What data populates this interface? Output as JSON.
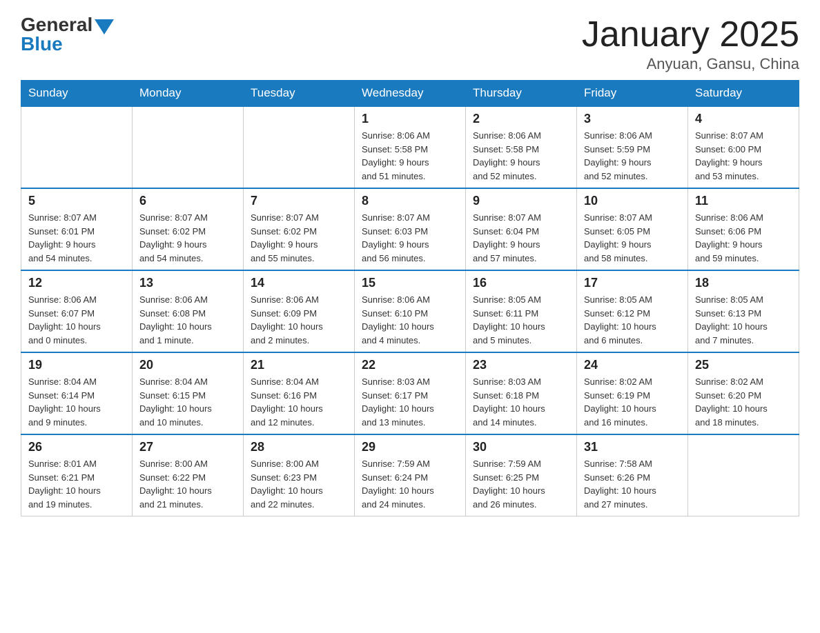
{
  "header": {
    "title": "January 2025",
    "subtitle": "Anyuan, Gansu, China",
    "logo_general": "General",
    "logo_blue": "Blue"
  },
  "days_of_week": [
    "Sunday",
    "Monday",
    "Tuesday",
    "Wednesday",
    "Thursday",
    "Friday",
    "Saturday"
  ],
  "weeks": [
    [
      {
        "day": "",
        "info": ""
      },
      {
        "day": "",
        "info": ""
      },
      {
        "day": "",
        "info": ""
      },
      {
        "day": "1",
        "info": "Sunrise: 8:06 AM\nSunset: 5:58 PM\nDaylight: 9 hours\nand 51 minutes."
      },
      {
        "day": "2",
        "info": "Sunrise: 8:06 AM\nSunset: 5:58 PM\nDaylight: 9 hours\nand 52 minutes."
      },
      {
        "day": "3",
        "info": "Sunrise: 8:06 AM\nSunset: 5:59 PM\nDaylight: 9 hours\nand 52 minutes."
      },
      {
        "day": "4",
        "info": "Sunrise: 8:07 AM\nSunset: 6:00 PM\nDaylight: 9 hours\nand 53 minutes."
      }
    ],
    [
      {
        "day": "5",
        "info": "Sunrise: 8:07 AM\nSunset: 6:01 PM\nDaylight: 9 hours\nand 54 minutes."
      },
      {
        "day": "6",
        "info": "Sunrise: 8:07 AM\nSunset: 6:02 PM\nDaylight: 9 hours\nand 54 minutes."
      },
      {
        "day": "7",
        "info": "Sunrise: 8:07 AM\nSunset: 6:02 PM\nDaylight: 9 hours\nand 55 minutes."
      },
      {
        "day": "8",
        "info": "Sunrise: 8:07 AM\nSunset: 6:03 PM\nDaylight: 9 hours\nand 56 minutes."
      },
      {
        "day": "9",
        "info": "Sunrise: 8:07 AM\nSunset: 6:04 PM\nDaylight: 9 hours\nand 57 minutes."
      },
      {
        "day": "10",
        "info": "Sunrise: 8:07 AM\nSunset: 6:05 PM\nDaylight: 9 hours\nand 58 minutes."
      },
      {
        "day": "11",
        "info": "Sunrise: 8:06 AM\nSunset: 6:06 PM\nDaylight: 9 hours\nand 59 minutes."
      }
    ],
    [
      {
        "day": "12",
        "info": "Sunrise: 8:06 AM\nSunset: 6:07 PM\nDaylight: 10 hours\nand 0 minutes."
      },
      {
        "day": "13",
        "info": "Sunrise: 8:06 AM\nSunset: 6:08 PM\nDaylight: 10 hours\nand 1 minute."
      },
      {
        "day": "14",
        "info": "Sunrise: 8:06 AM\nSunset: 6:09 PM\nDaylight: 10 hours\nand 2 minutes."
      },
      {
        "day": "15",
        "info": "Sunrise: 8:06 AM\nSunset: 6:10 PM\nDaylight: 10 hours\nand 4 minutes."
      },
      {
        "day": "16",
        "info": "Sunrise: 8:05 AM\nSunset: 6:11 PM\nDaylight: 10 hours\nand 5 minutes."
      },
      {
        "day": "17",
        "info": "Sunrise: 8:05 AM\nSunset: 6:12 PM\nDaylight: 10 hours\nand 6 minutes."
      },
      {
        "day": "18",
        "info": "Sunrise: 8:05 AM\nSunset: 6:13 PM\nDaylight: 10 hours\nand 7 minutes."
      }
    ],
    [
      {
        "day": "19",
        "info": "Sunrise: 8:04 AM\nSunset: 6:14 PM\nDaylight: 10 hours\nand 9 minutes."
      },
      {
        "day": "20",
        "info": "Sunrise: 8:04 AM\nSunset: 6:15 PM\nDaylight: 10 hours\nand 10 minutes."
      },
      {
        "day": "21",
        "info": "Sunrise: 8:04 AM\nSunset: 6:16 PM\nDaylight: 10 hours\nand 12 minutes."
      },
      {
        "day": "22",
        "info": "Sunrise: 8:03 AM\nSunset: 6:17 PM\nDaylight: 10 hours\nand 13 minutes."
      },
      {
        "day": "23",
        "info": "Sunrise: 8:03 AM\nSunset: 6:18 PM\nDaylight: 10 hours\nand 14 minutes."
      },
      {
        "day": "24",
        "info": "Sunrise: 8:02 AM\nSunset: 6:19 PM\nDaylight: 10 hours\nand 16 minutes."
      },
      {
        "day": "25",
        "info": "Sunrise: 8:02 AM\nSunset: 6:20 PM\nDaylight: 10 hours\nand 18 minutes."
      }
    ],
    [
      {
        "day": "26",
        "info": "Sunrise: 8:01 AM\nSunset: 6:21 PM\nDaylight: 10 hours\nand 19 minutes."
      },
      {
        "day": "27",
        "info": "Sunrise: 8:00 AM\nSunset: 6:22 PM\nDaylight: 10 hours\nand 21 minutes."
      },
      {
        "day": "28",
        "info": "Sunrise: 8:00 AM\nSunset: 6:23 PM\nDaylight: 10 hours\nand 22 minutes."
      },
      {
        "day": "29",
        "info": "Sunrise: 7:59 AM\nSunset: 6:24 PM\nDaylight: 10 hours\nand 24 minutes."
      },
      {
        "day": "30",
        "info": "Sunrise: 7:59 AM\nSunset: 6:25 PM\nDaylight: 10 hours\nand 26 minutes."
      },
      {
        "day": "31",
        "info": "Sunrise: 7:58 AM\nSunset: 6:26 PM\nDaylight: 10 hours\nand 27 minutes."
      },
      {
        "day": "",
        "info": ""
      }
    ]
  ]
}
